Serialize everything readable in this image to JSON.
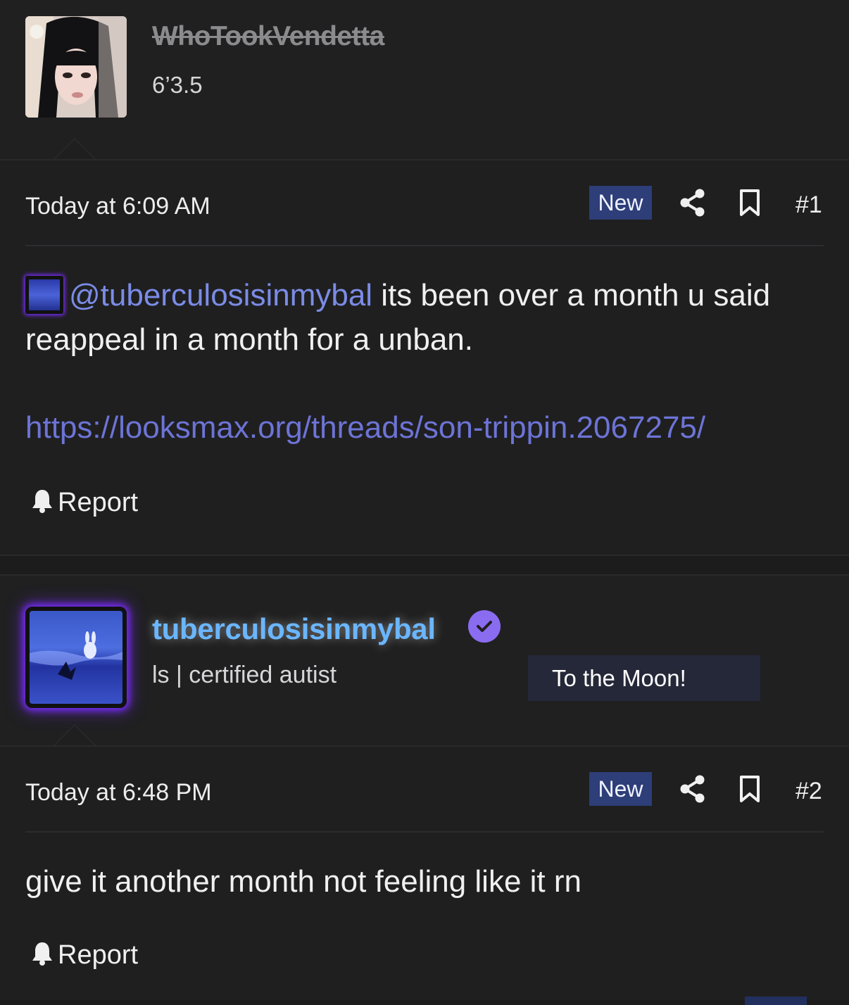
{
  "post1": {
    "author": "WhoTookVendetta",
    "user_title": "6’3.5",
    "timestamp": "Today at 6:09 AM",
    "badge": "New",
    "post_number": "#1",
    "mention": "@tuberculosisinmybal",
    "message_rest": " its been over a month u said reappeal in a month for a unban.",
    "link": "https://looksmax.org/threads/son-trippin.2067275/",
    "report_label": "Report"
  },
  "post2": {
    "author": "tuberculosisinmybal",
    "user_title": "ls | certified autist",
    "banner": "To the Moon!",
    "timestamp": "Today at 6:48 PM",
    "badge": "New",
    "post_number": "#2",
    "message": "give it another month not feeling like it rn",
    "report_label": "Report"
  },
  "colors": {
    "background": "#1c1c1d",
    "username2": "#6ab6ff",
    "mention": "#7b8ce6",
    "link": "#6d74d6",
    "badge_bg": "#2d3e78",
    "verified": "#8a6cf0",
    "avatar_glow": "#7a2cff"
  },
  "icons": [
    "share-icon",
    "bookmark-icon",
    "bell-icon",
    "verified-check-icon"
  ]
}
